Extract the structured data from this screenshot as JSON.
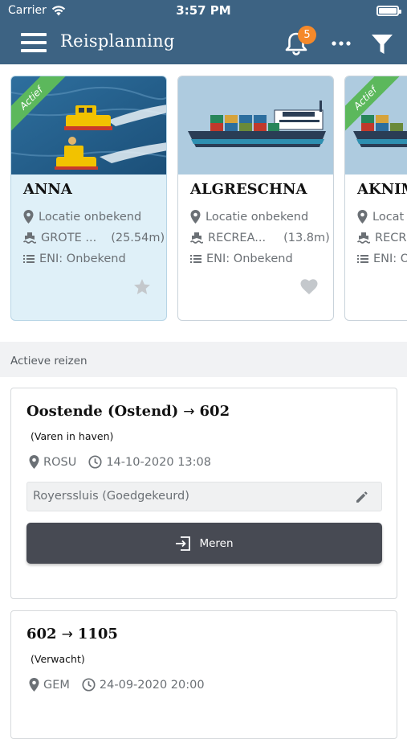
{
  "status_bar": {
    "carrier": "Carrier",
    "time": "3:57 PM"
  },
  "header": {
    "title": "Reisplanning",
    "notification_count": "5",
    "icons": [
      "menu-icon",
      "bell-icon",
      "more-icon",
      "filter-icon"
    ]
  },
  "colors": {
    "header_bg": "#3d6383",
    "badge": "#f5892a",
    "active_ribbon": "#5cb85c",
    "active_card_bg": "#dff0f8",
    "button_bg": "#474a53"
  },
  "vessels": [
    {
      "name": "ANNA",
      "ribbon": "Actief",
      "location": "Locatie onbekend",
      "type": "GROTE ...",
      "length": "(25.54m)",
      "eni": "ENI: Onbekend",
      "fav_icon": "star-icon"
    },
    {
      "name": "ALGRESCHNA",
      "ribbon": "",
      "location": "Locatie onbekend",
      "type": "RECREA...",
      "length": "(13.8m)",
      "eni": "ENI: Onbekend",
      "fav_icon": "heart-icon"
    },
    {
      "name": "AKNIM",
      "ribbon": "Actief",
      "location": "Locat",
      "type": "RECR",
      "length": "",
      "eni": "ENI: O",
      "fav_icon": ""
    }
  ],
  "section": {
    "title": "Actieve reizen"
  },
  "trips": [
    {
      "from": "Oostende (Ostend)",
      "arrow": "→",
      "to": "602",
      "status": "(Varen in haven)",
      "place": "ROSU",
      "datetime": "14-10-2020 13:08",
      "lock": "Royerssluis (Goedgekeurd)",
      "action_label": "Meren"
    },
    {
      "from": "602",
      "arrow": "→",
      "to": "1105",
      "status": "(Verwacht)",
      "place": "GEM",
      "datetime": "24-09-2020 20:00"
    }
  ]
}
